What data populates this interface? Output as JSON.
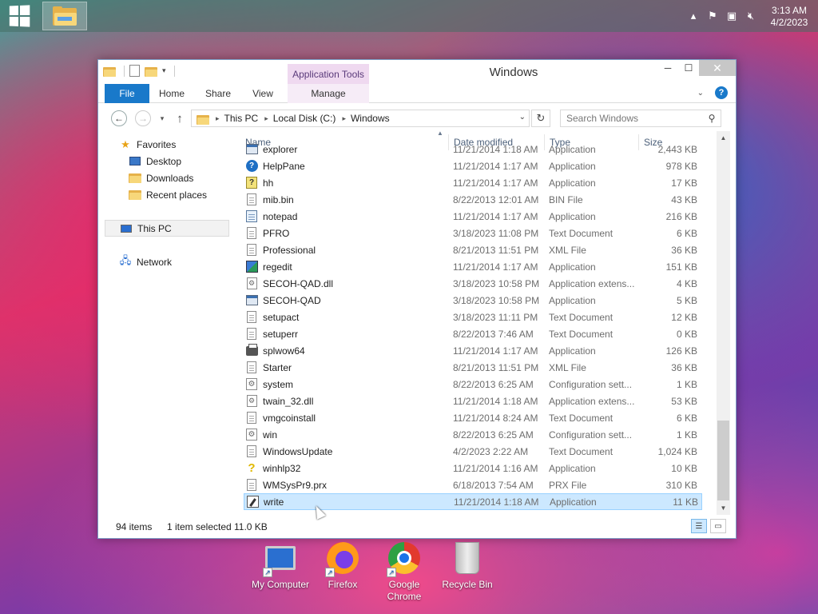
{
  "taskbar": {
    "clock_time": "3:13 AM",
    "clock_date": "4/2/2023",
    "tray_icons": [
      "chevron-up-icon",
      "flag-error-icon",
      "network-error-icon",
      "volume-muted-icon"
    ]
  },
  "window": {
    "title": "Windows",
    "context_tab_group": "Application Tools",
    "tabs": {
      "file": "File",
      "home": "Home",
      "share": "Share",
      "view": "View",
      "manage": "Manage"
    },
    "minimize": "─",
    "maximize": "☐",
    "close": "✕",
    "help": "?"
  },
  "address": {
    "crumbs": [
      "This PC",
      "Local Disk (C:)",
      "Windows"
    ],
    "search_placeholder": "Search Windows"
  },
  "navpane": {
    "favorites": "Favorites",
    "desktop": "Desktop",
    "downloads": "Downloads",
    "recent_places": "Recent places",
    "this_pc": "This PC",
    "network": "Network"
  },
  "columns": {
    "name": "Name",
    "date": "Date modified",
    "type": "Type",
    "size": "Size"
  },
  "files": [
    {
      "name": "explorer",
      "date": "11/21/2014 1:18 AM",
      "type": "Application",
      "size": "2,443 KB",
      "icon": "app"
    },
    {
      "name": "HelpPane",
      "date": "11/21/2014 1:17 AM",
      "type": "Application",
      "size": "978 KB",
      "icon": "help"
    },
    {
      "name": "hh",
      "date": "11/21/2014 1:17 AM",
      "type": "Application",
      "size": "17 KB",
      "icon": "hh"
    },
    {
      "name": "mib.bin",
      "date": "8/22/2013 12:01 AM",
      "type": "BIN File",
      "size": "43 KB",
      "icon": "doc"
    },
    {
      "name": "notepad",
      "date": "11/21/2014 1:17 AM",
      "type": "Application",
      "size": "216 KB",
      "icon": "note"
    },
    {
      "name": "PFRO",
      "date": "3/18/2023 11:08 PM",
      "type": "Text Document",
      "size": "6 KB",
      "icon": "doc"
    },
    {
      "name": "Professional",
      "date": "8/21/2013 11:51 PM",
      "type": "XML File",
      "size": "36 KB",
      "icon": "doc"
    },
    {
      "name": "regedit",
      "date": "11/21/2014 1:17 AM",
      "type": "Application",
      "size": "151 KB",
      "icon": "regedit"
    },
    {
      "name": "SECOH-QAD.dll",
      "date": "3/18/2023 10:58 PM",
      "type": "Application extens...",
      "size": "4 KB",
      "icon": "dll"
    },
    {
      "name": "SECOH-QAD",
      "date": "3/18/2023 10:58 PM",
      "type": "Application",
      "size": "5 KB",
      "icon": "app"
    },
    {
      "name": "setupact",
      "date": "3/18/2023 11:11 PM",
      "type": "Text Document",
      "size": "12 KB",
      "icon": "doc"
    },
    {
      "name": "setuperr",
      "date": "8/22/2013 7:46 AM",
      "type": "Text Document",
      "size": "0 KB",
      "icon": "doc"
    },
    {
      "name": "splwow64",
      "date": "11/21/2014 1:17 AM",
      "type": "Application",
      "size": "126 KB",
      "icon": "printer"
    },
    {
      "name": "Starter",
      "date": "8/21/2013 11:51 PM",
      "type": "XML File",
      "size": "36 KB",
      "icon": "doc"
    },
    {
      "name": "system",
      "date": "8/22/2013 6:25 AM",
      "type": "Configuration sett...",
      "size": "1 KB",
      "icon": "gear"
    },
    {
      "name": "twain_32.dll",
      "date": "11/21/2014 1:18 AM",
      "type": "Application extens...",
      "size": "53 KB",
      "icon": "dll"
    },
    {
      "name": "vmgcoinstall",
      "date": "11/21/2014 8:24 AM",
      "type": "Text Document",
      "size": "6 KB",
      "icon": "doc"
    },
    {
      "name": "win",
      "date": "8/22/2013 6:25 AM",
      "type": "Configuration sett...",
      "size": "1 KB",
      "icon": "gear"
    },
    {
      "name": "WindowsUpdate",
      "date": "4/2/2023 2:22 AM",
      "type": "Text Document",
      "size": "1,024 KB",
      "icon": "doc"
    },
    {
      "name": "winhlp32",
      "date": "11/21/2014 1:16 AM",
      "type": "Application",
      "size": "10 KB",
      "icon": "q"
    },
    {
      "name": "WMSysPr9.prx",
      "date": "6/18/2013 7:54 AM",
      "type": "PRX File",
      "size": "310 KB",
      "icon": "doc"
    },
    {
      "name": "write",
      "date": "11/21/2014 1:18 AM",
      "type": "Application",
      "size": "11 KB",
      "icon": "write",
      "selected": true
    }
  ],
  "status": {
    "count": "94 items",
    "selected": "1 item selected",
    "size": "11.0 KB"
  },
  "desktop_icons": [
    {
      "label": "My Computer",
      "icon": "monitor"
    },
    {
      "label": "Firefox",
      "icon": "firefox"
    },
    {
      "label": "Google Chrome",
      "icon": "chrome"
    },
    {
      "label": "Recycle Bin",
      "icon": "bin"
    }
  ]
}
